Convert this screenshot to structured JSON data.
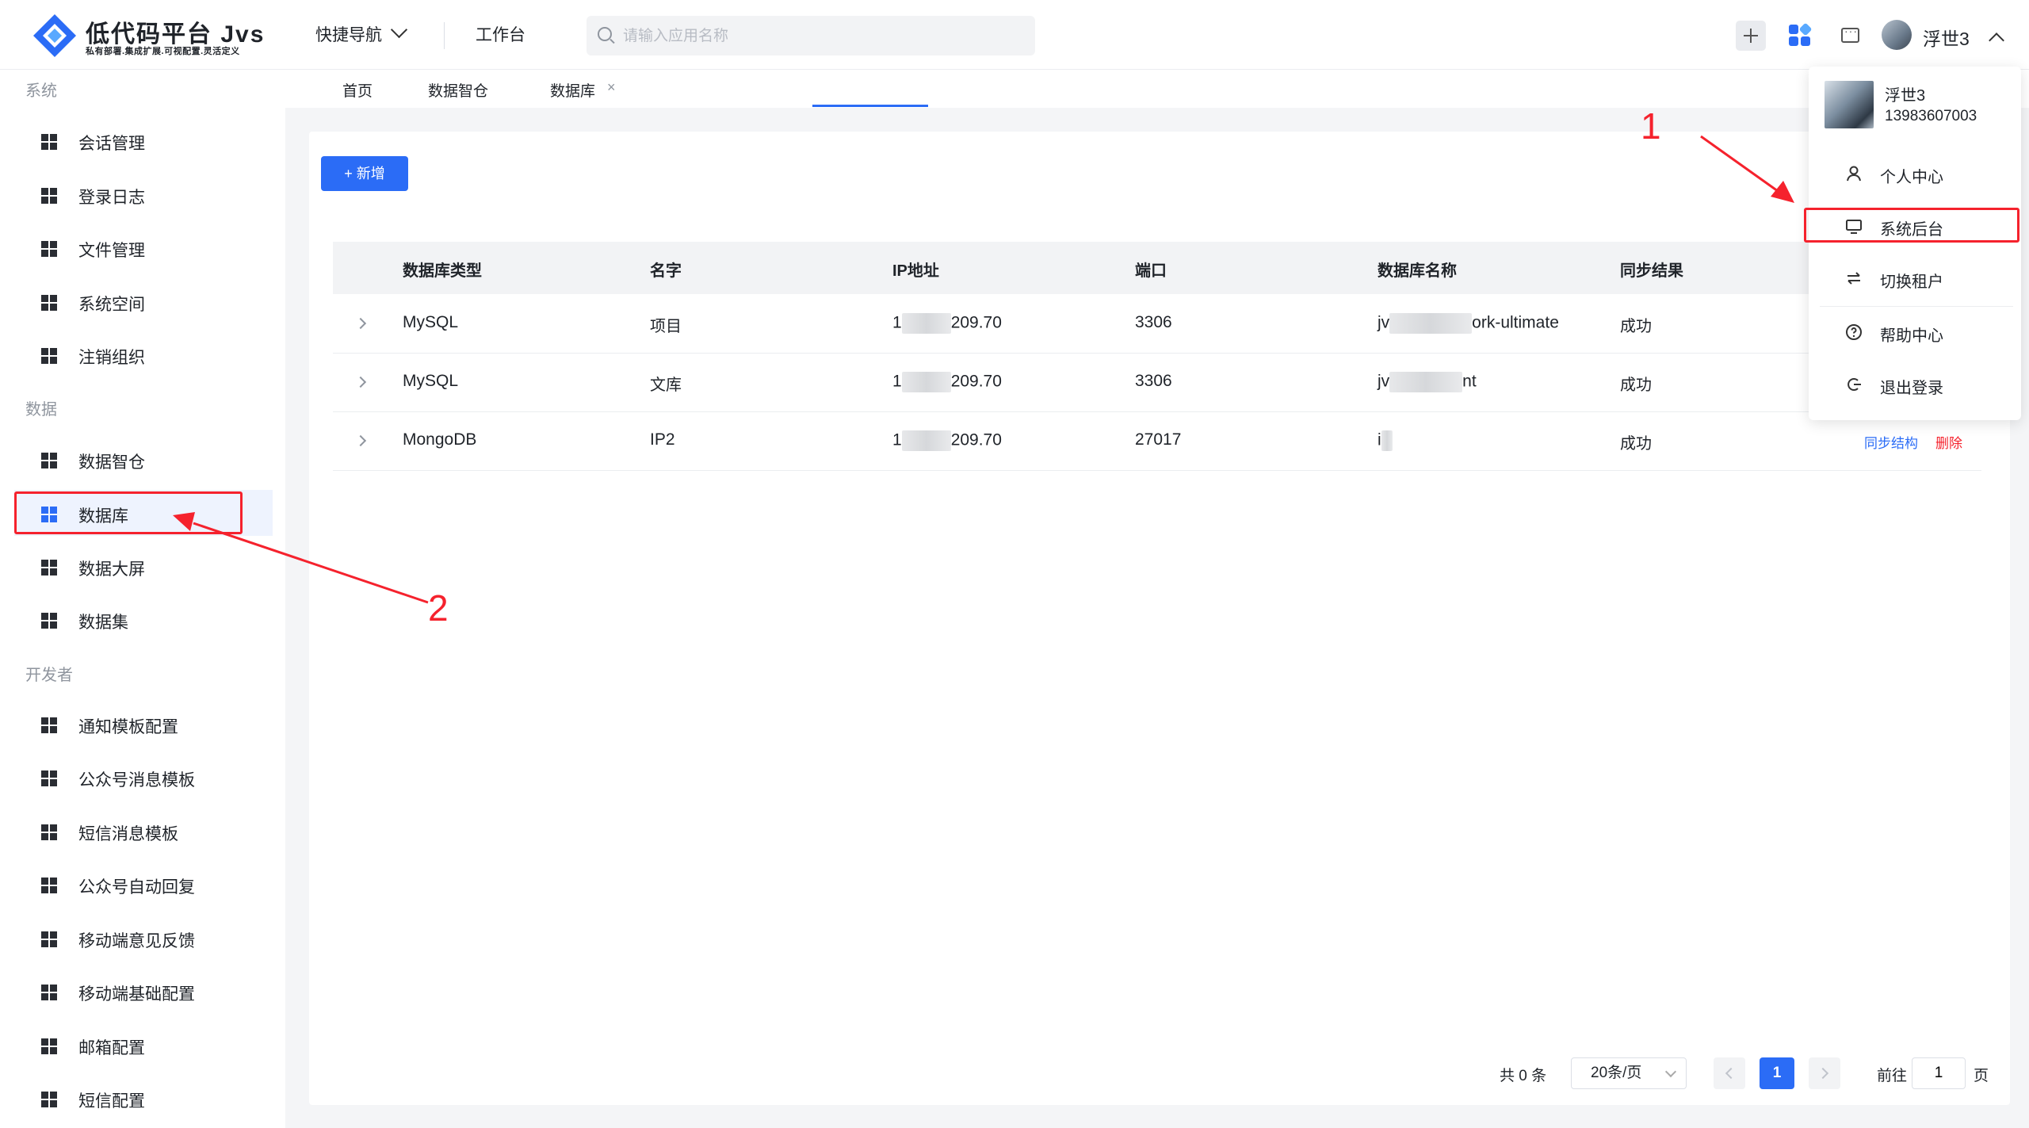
{
  "header": {
    "logo_title": "低代码平台 Jvs",
    "logo_subtitle": "私有部署.集成扩展.可视配置.灵活定义",
    "quick_nav": "快捷导航",
    "workbench": "工作台",
    "search_placeholder": "请输入应用名称",
    "user_name": "浮世3"
  },
  "sidebar": {
    "sections": [
      {
        "title": "系统",
        "items": [
          "会话管理",
          "登录日志",
          "文件管理",
          "系统空间",
          "注销组织"
        ]
      },
      {
        "title": "数据",
        "items": [
          "数据智仓",
          "数据库",
          "数据大屏",
          "数据集"
        ]
      },
      {
        "title": "开发者",
        "items": [
          "通知模板配置",
          "公众号消息模板",
          "短信消息模板",
          "公众号自动回复",
          "移动端意见反馈",
          "移动端基础配置",
          "邮箱配置",
          "短信配置"
        ]
      }
    ],
    "active_item": "数据库"
  },
  "tabs": [
    "首页",
    "数据智仓",
    "数据库"
  ],
  "tab_close": "×",
  "toolbar": {
    "add_label": "+ 新增"
  },
  "table": {
    "columns": [
      "数据库类型",
      "名字",
      "IP地址",
      "端口",
      "数据库名称",
      "同步结果"
    ],
    "rows": [
      {
        "type": "MySQL",
        "name": "项目",
        "ip_prefix": "1",
        "ip_suffix": "209.70",
        "port": "3306",
        "db_prefix": "jv",
        "db_suffix": "ork-ultimate",
        "result": "成功"
      },
      {
        "type": "MySQL",
        "name": "文库",
        "ip_prefix": "1",
        "ip_suffix": "209.70",
        "port": "3306",
        "db_prefix": "jv",
        "db_suffix": "nt",
        "result": "成功"
      },
      {
        "type": "MongoDB",
        "name": "IP2",
        "ip_prefix": "1",
        "ip_suffix": "209.70",
        "port": "27017",
        "db_prefix": "i",
        "db_suffix": "",
        "result": "成功"
      }
    ],
    "row_actions": {
      "sync": "同步结构",
      "delete": "删除"
    }
  },
  "pagination": {
    "total": "共 0 条",
    "page_size": "20条/页",
    "current_page": "1",
    "goto_label": "前往",
    "goto_value": "1",
    "page_unit": "页"
  },
  "user_menu": {
    "name": "浮世3",
    "phone": "13983607003",
    "items": [
      "个人中心",
      "系统后台",
      "切换租户",
      "帮助中心",
      "退出登录"
    ]
  },
  "annotations": {
    "label_1": "1",
    "label_2": "2"
  },
  "colors": {
    "primary": "#2b6cf6",
    "danger": "#f5222d",
    "annotation": "#f5222d"
  },
  "icons": {
    "menu_item": "grid-icon",
    "user_menu": [
      "user-icon",
      "monitor-icon",
      "swap-icon",
      "help-icon",
      "logout-icon"
    ]
  }
}
